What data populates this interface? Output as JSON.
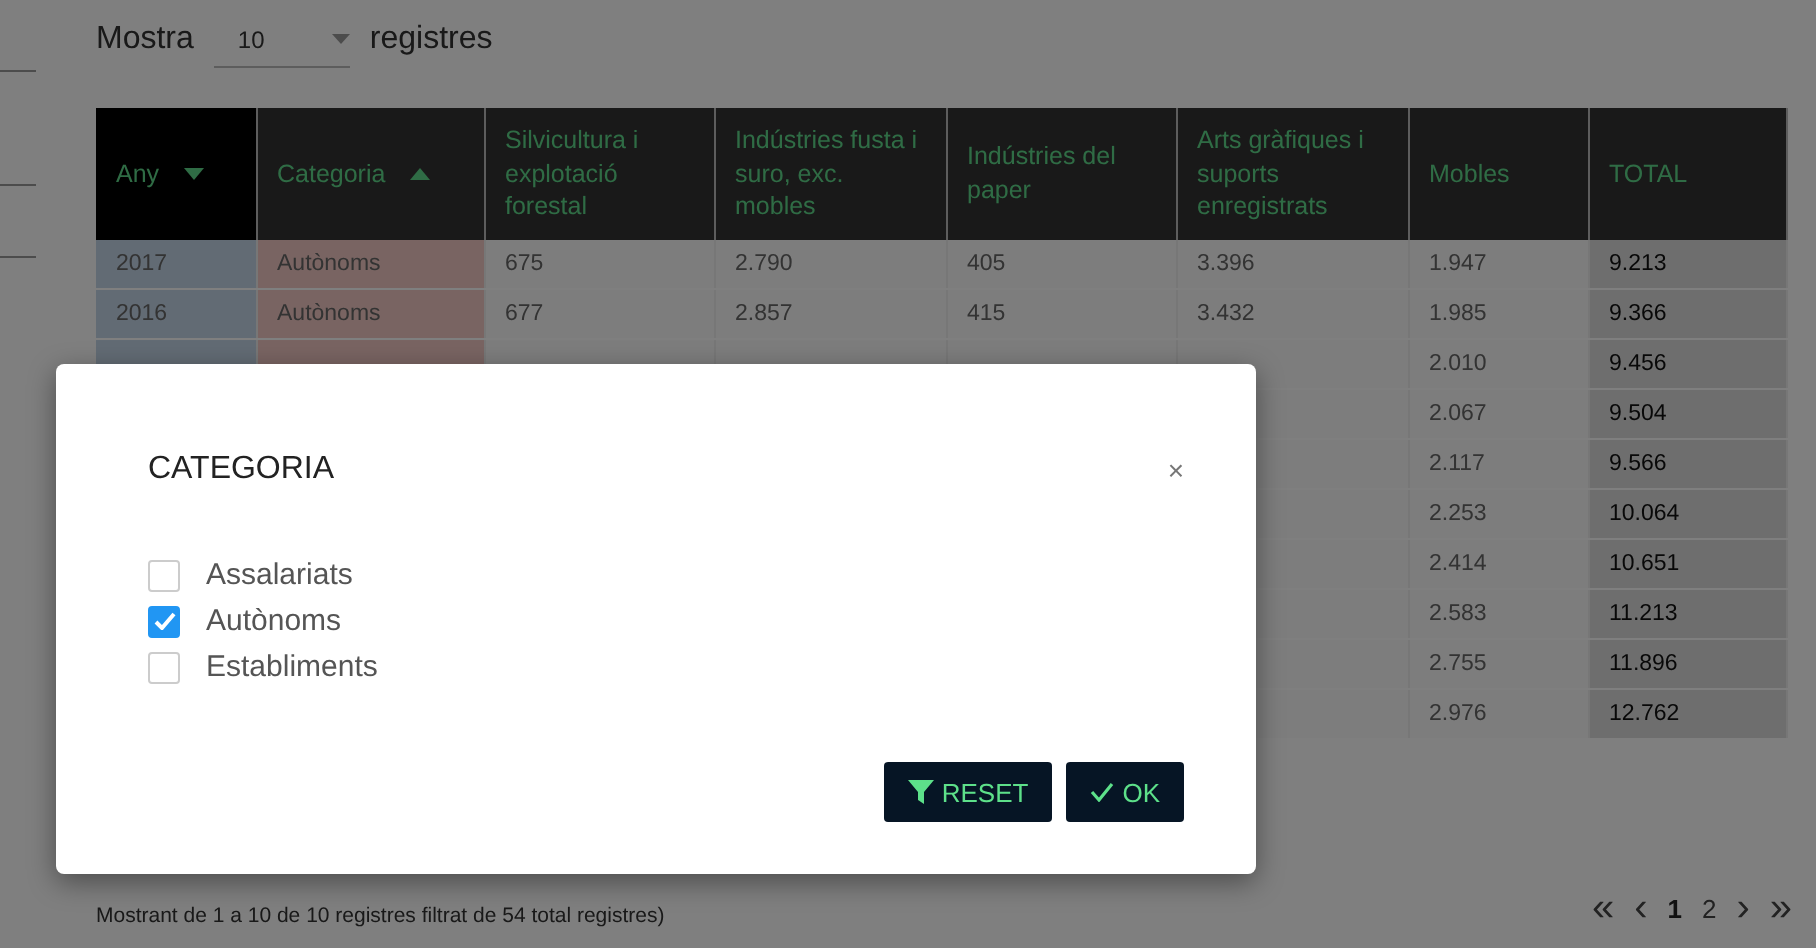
{
  "length_control": {
    "prefix": "Mostra",
    "value": "10",
    "suffix": "registres"
  },
  "table": {
    "columns": [
      {
        "label": "Any",
        "sorted": true,
        "ascending": false
      },
      {
        "label": "Categoria",
        "sorted": true,
        "ascending": true
      },
      {
        "label": "Silvicultura i explotació forestal",
        "sorted": false
      },
      {
        "label": "Indústries fusta i suro, exc. mobles",
        "sorted": false
      },
      {
        "label": "Indústries del paper",
        "sorted": false
      },
      {
        "label": "Arts gràfiques i suports enregistrats",
        "sorted": false
      },
      {
        "label": "Mobles",
        "sorted": false
      },
      {
        "label": "TOTAL",
        "sorted": false
      }
    ],
    "rows": [
      {
        "kind": "full",
        "cells": [
          "2017",
          "Autònoms",
          "675",
          "2.790",
          "405",
          "3.396",
          "1.947",
          "9.213"
        ]
      },
      {
        "kind": "full",
        "cells": [
          "2016",
          "Autònoms",
          "677",
          "2.857",
          "415",
          "3.432",
          "1.985",
          "9.366"
        ]
      },
      {
        "kind": "partial",
        "cells": [
          "2.010",
          "9.456"
        ]
      },
      {
        "kind": "partial",
        "cells": [
          "2.067",
          "9.504"
        ]
      },
      {
        "kind": "partial",
        "cells": [
          "2.117",
          "9.566"
        ]
      },
      {
        "kind": "partial",
        "cells": [
          "2.253",
          "10.064"
        ]
      },
      {
        "kind": "partial",
        "cells": [
          "2.414",
          "10.651"
        ]
      },
      {
        "kind": "partial",
        "cells": [
          "2.583",
          "11.213"
        ]
      },
      {
        "kind": "partial",
        "cells": [
          "2.755",
          "11.896"
        ]
      },
      {
        "kind": "partial",
        "cells": [
          "2.976",
          "12.762"
        ]
      }
    ]
  },
  "info": "Mostrant de 1 a 10 de 10 registres filtrat de 54 total registres)",
  "pagination": {
    "first": "«",
    "prev": "‹",
    "pages": [
      {
        "label": "1",
        "selected": true
      },
      {
        "label": "2",
        "selected": false
      }
    ],
    "next": "›",
    "last": "»"
  },
  "dialog": {
    "title": "CATEGORIA",
    "close": "×",
    "options": [
      {
        "label": "Assalariats",
        "checked": false
      },
      {
        "label": "Autònoms",
        "checked": true
      },
      {
        "label": "Establiments",
        "checked": false
      }
    ],
    "buttons": [
      {
        "kind": "reset",
        "label": "RESET"
      },
      {
        "kind": "ok",
        "label": "OK"
      }
    ]
  }
}
